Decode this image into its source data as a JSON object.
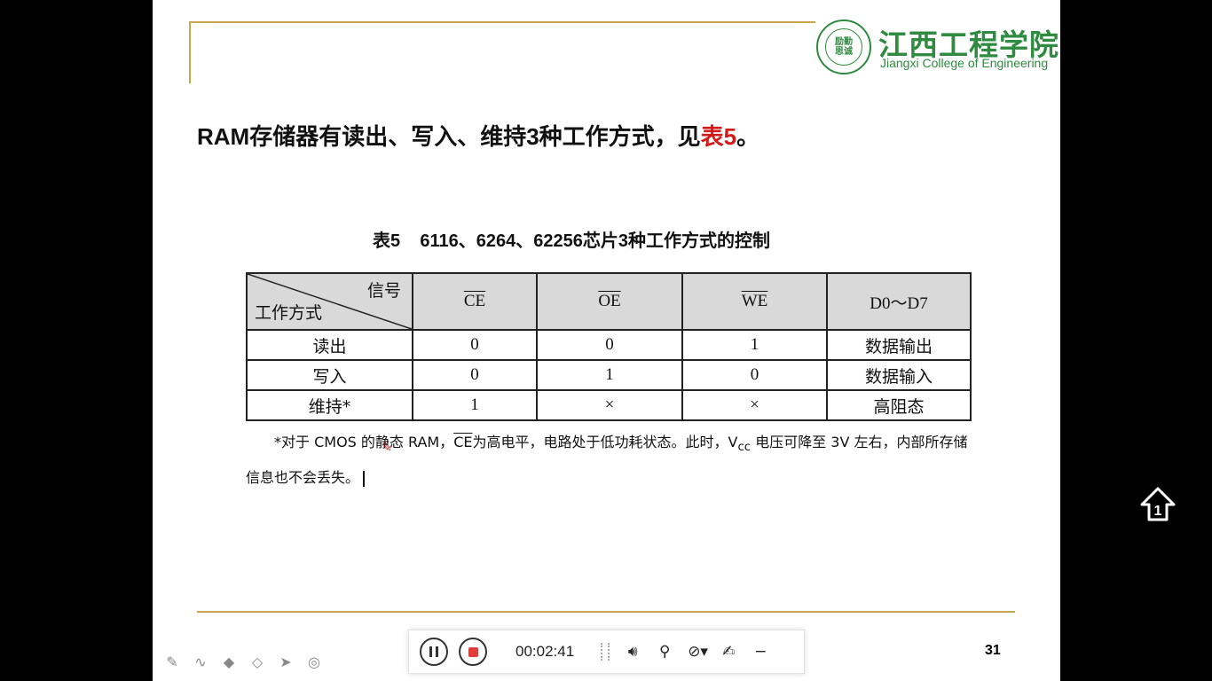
{
  "slide": {
    "logo": {
      "cn": "江西工程学院",
      "en": "Jiangxi College of Engineering",
      "seal_text": "励勤\n思诚"
    },
    "heading": {
      "main": "RAM存储器有读出、写入、维持3种工作方式，见",
      "ref": "表5",
      "end": "。"
    },
    "table_caption": "表5    6116、6264、62256芯片3种工作方式的控制",
    "table": {
      "corner_signal": "信号",
      "corner_mode": "工作方式",
      "headers": [
        "CE",
        "OE",
        "WE",
        "D0～D7"
      ],
      "rows": [
        [
          "读出",
          "0",
          "0",
          "1",
          "数据输出"
        ],
        [
          "写入",
          "0",
          "1",
          "0",
          "数据输入"
        ],
        [
          "维持*",
          "1",
          "×",
          "×",
          "高阻态"
        ]
      ]
    },
    "note": {
      "p1": "*对于 CMOS 的静态 RAM，",
      "ce": "CE",
      "p2": "为高电平，电路处于低功耗状态。此时，V",
      "sub": "cc",
      "p3": " 电压可降至 3V 左右，内部所存储",
      "line2": "信息也不会丢失。"
    },
    "slide_number": "31"
  },
  "player": {
    "time": "00:02:41",
    "icons": [
      "pause-icon",
      "stop-icon",
      "volume-icon",
      "microphone-icon",
      "camera-off-icon",
      "pen-icon",
      "minimize-icon"
    ],
    "stop_color": "#e03c3c"
  },
  "toolbar": {
    "icons": [
      "pencil-icon",
      "curve-icon",
      "highlighter-icon",
      "eraser-icon",
      "pointer-icon",
      "laser-icon"
    ]
  },
  "colors": {
    "accent_gold": "#c8a64b",
    "logo_green": "#2e8b3f",
    "highlight_red": "#d21a1a"
  }
}
